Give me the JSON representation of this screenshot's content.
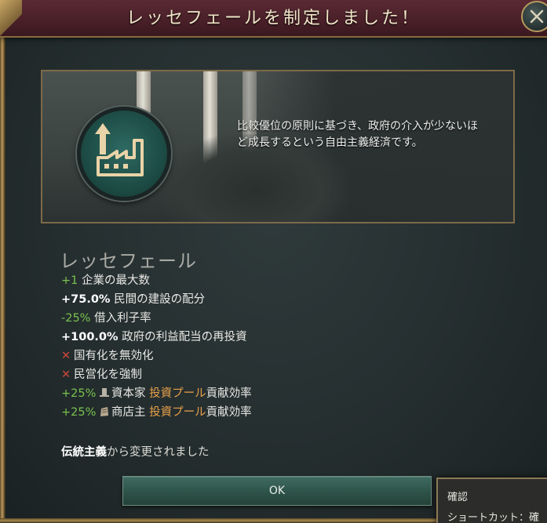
{
  "dialog": {
    "title": "レッセフェールを制定しました！",
    "description": "比較優位の原則に基づき、政府の介入が少ないほど成長するという自由主義経済です。",
    "policy_name": "レッセフェール",
    "effects": [
      {
        "value": "+1",
        "text": " 企業の最大数"
      },
      {
        "value": "+75.0%",
        "text": " 民間の建設の配分"
      },
      {
        "value": "-25%",
        "text": " 借入利子率"
      },
      {
        "value": "+100.0%",
        "text": " 政府の利益配当の再投資"
      },
      {
        "mark": "✕",
        "text": "国有化を無効化"
      },
      {
        "mark": "✕",
        "text": "民営化を強制"
      },
      {
        "value": "+25%",
        "group": "資本家",
        "link": "投資プール",
        "suffix": "貢献効率"
      },
      {
        "value": "+25%",
        "group": "商店主",
        "link": "投資プール",
        "suffix": "貢献効率"
      }
    ],
    "changed_from": {
      "highlight": "伝統主義",
      "rest": "から変更されました"
    },
    "ok_label": "OK"
  },
  "tooltip": {
    "title": "確認",
    "shortcut": "ショートカット：確"
  },
  "colors": {
    "header": "#4a2029",
    "positive": "#79c24e",
    "negative": "#d0473c",
    "link": "#e8a14a",
    "button": "#2f554b"
  },
  "icons": [
    "close-icon",
    "factory-growth-icon",
    "top-hat-icon",
    "shopkeeper-icon",
    "x-mark-icon"
  ]
}
